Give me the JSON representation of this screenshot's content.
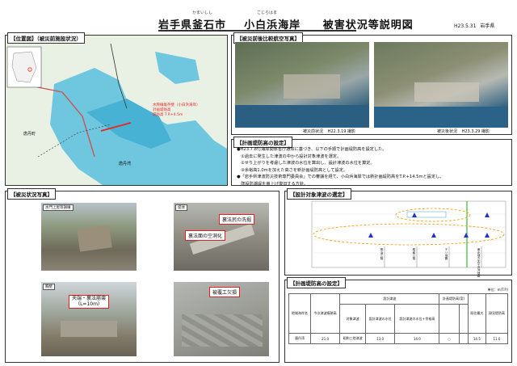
{
  "header": {
    "prefecture_city": "岩手県釜石市",
    "city_ruby": "かまいしし",
    "coast_name": "小白浜海岸",
    "coast_ruby": "こじらはま",
    "doc_title": "被害状況等説明図",
    "date": "H23.5.31",
    "org": "岩手県"
  },
  "location_map": {
    "caption": "【位置図】（被災前施設状況）",
    "legend_red": "水際線既存壁（小白浜海岸）",
    "legend_lines": [
      "計画堤防高",
      "堤防高 T.P.+4.5m"
    ],
    "place_labels": [
      "唐丹町",
      "唐丹湾"
    ]
  },
  "aerial": {
    "caption": "【被災前後比較航空写真】",
    "before_label": "被災前状況",
    "before_date": "H22.3.19 撮影",
    "after_label": "被災後状況",
    "after_date": "H23.3.29 撮影"
  },
  "plan_setting": {
    "caption": "【計画堤防高の設定】",
    "lines": [
      "●H23.7.8付海岸関係省庁通知に基づき、以下の手順で計画堤防高を設定した。",
      "　①過去に発生した津波の中から設計対象津波を選定。",
      "　②せり上がりを考慮した津波の水位を算出し、設計津波の水位を算定。",
      "　③余裕高1.0mを加えた高さを新計画堤防高として設定。",
      "●「岩手県津波防災技術専門委員会」での審議を経て、小白浜海岸では新計画堤防高をT.P.+14.5mと設定し、",
      "　既設防潮堤を嵩上げ復旧する方針。"
    ]
  },
  "damage_photos": {
    "caption": "【被災状況写真】",
    "p1_label": "水門上屋等損壊",
    "p2_label": "堤体",
    "p2_tag1": "裏法尻の洗掘",
    "p2_tag2": "裏法面の空洞化",
    "p3_label": "胸壁",
    "p3_tag": "天端・裏法崩壊",
    "p3_tag2": "（L=10m）",
    "p4_tag": "被覆工欠損"
  },
  "design_wave": {
    "caption": "【設計対象津波の選定】",
    "series_labels": [
      "明治三陸",
      "昭和三陸",
      "チリ地震",
      "東北地方太平洋沖地震"
    ]
  },
  "plan_height": {
    "caption": "【計画堤防高の設定】",
    "unit": "単位：m(T.P.)",
    "headers": [
      "地域海岸名",
      "今次津波痕跡高",
      "設計津波",
      "",
      "",
      "計画堤防高(案)",
      "",
      "既往最大",
      "",
      "現況堤防高"
    ],
    "sub_headers": [
      "対象津波",
      "設計津波の水位",
      "設計津波の水位＋余裕高"
    ],
    "row": [
      "唐丹湾",
      "21.0",
      "昭和三陸津波",
      "13.0",
      "14.0",
      "○",
      "",
      "14.5",
      "",
      "11.0"
    ]
  }
}
